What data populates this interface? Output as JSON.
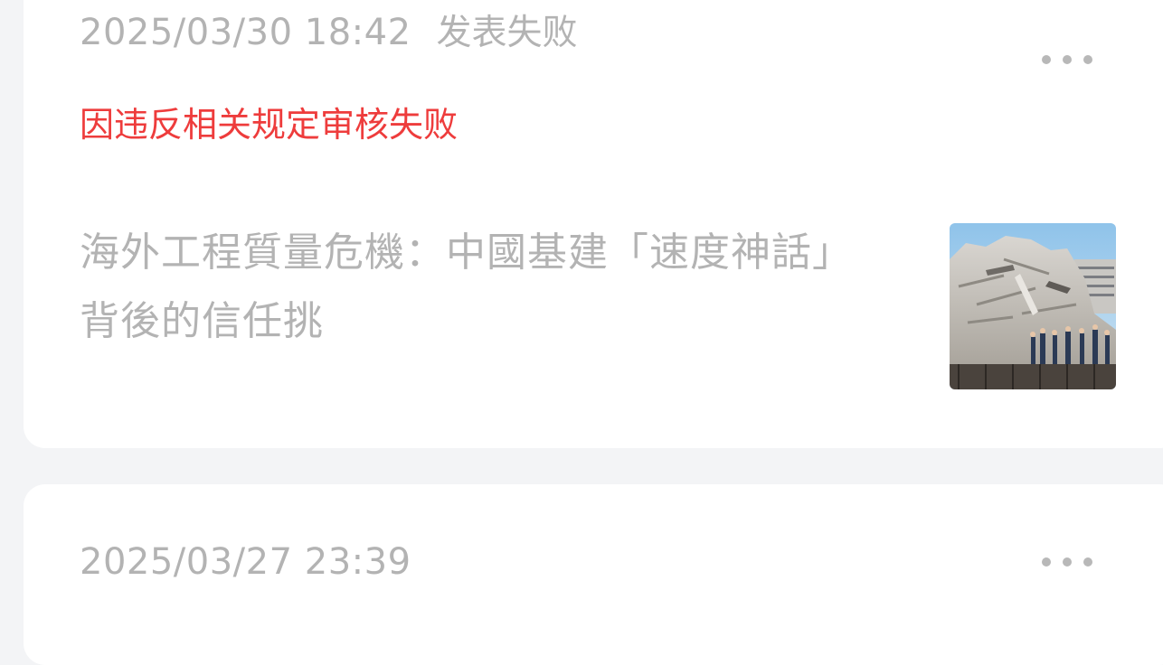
{
  "posts": [
    {
      "timestamp": "2025/03/30 18:42",
      "status": "发表失败",
      "reject_reason": "因违反相关规定审核失败",
      "title": "海外工程質量危機：中國基建「速度神話」背後的信任挑",
      "more_icon": "more-horizontal-icon",
      "thumbnail": "collapsed-building-rubble-photo"
    },
    {
      "timestamp": "2025/03/27 23:39",
      "more_icon": "more-horizontal-icon"
    }
  ],
  "colors": {
    "page_bg": "#f3f4f6",
    "card_bg": "#ffffff",
    "meta_text": "#b3b3b3",
    "error_red": "#ee3c3c",
    "dot": "#b8b8b8"
  }
}
